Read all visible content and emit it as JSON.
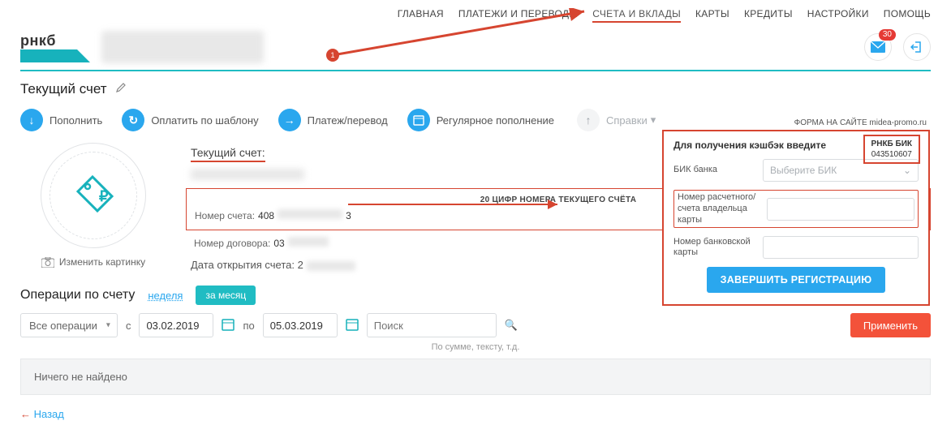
{
  "nav": {
    "items": [
      "ГЛАВНАЯ",
      "ПЛАТЕЖИ И ПЕРЕВОДЫ",
      "СЧЕТА И ВКЛАДЫ",
      "КАРТЫ",
      "КРЕДИТЫ",
      "НАСТРОЙКИ",
      "ПОМОЩЬ"
    ],
    "activeIndex": 2
  },
  "brand": {
    "text": "рнкб"
  },
  "header_icons": {
    "mail_badge": "30"
  },
  "account": {
    "title": "Текущий счет",
    "actions": {
      "topup": "Пополнить",
      "pay_template": "Оплатить по шаблону",
      "transfer": "Платеж/перевод",
      "recurring": "Регулярное пополнение",
      "references": "Справки"
    },
    "change_picture": "Изменить картинку",
    "label": "Текущий счет:",
    "digits_title": "20 ЦИФР НОМЕРА ТЕКУЩЕГО СЧЁТА",
    "number_label": "Номер счета:",
    "number_prefix": "408",
    "number_suffix": "3",
    "contract_label": "Номер договора:",
    "contract_prefix": "03",
    "open_date_label": "Дата открытия счета:",
    "open_date_prefix": "2"
  },
  "form": {
    "site_note": "ФОРМА НА САЙТЕ midea-promo.ru",
    "title": "Для получения кэшбэк введите",
    "bik_badge_label": "РНКБ БИК",
    "bik_badge_value": "043510607",
    "bik_label": "БИК банка",
    "bik_placeholder": "Выберите БИК",
    "acct_label": "Номер расчетного/счета владельца карты",
    "card_label": "Номер банковской карты",
    "submit": "ЗАВЕРШИТЬ РЕГИСТРАЦИЮ"
  },
  "ops": {
    "title": "Операции по счету",
    "week": "неделя",
    "month": "за месяц",
    "all_ops": "Все операции",
    "from_lbl": "с",
    "to_lbl": "по",
    "date_from": "03.02.2019",
    "date_to": "05.03.2019",
    "search_placeholder": "Поиск",
    "apply": "Применить",
    "hint": "По сумме, тексту, т.д.",
    "empty": "Ничего не найдено",
    "back": "Назад"
  },
  "annotation": {
    "pin": "1"
  }
}
